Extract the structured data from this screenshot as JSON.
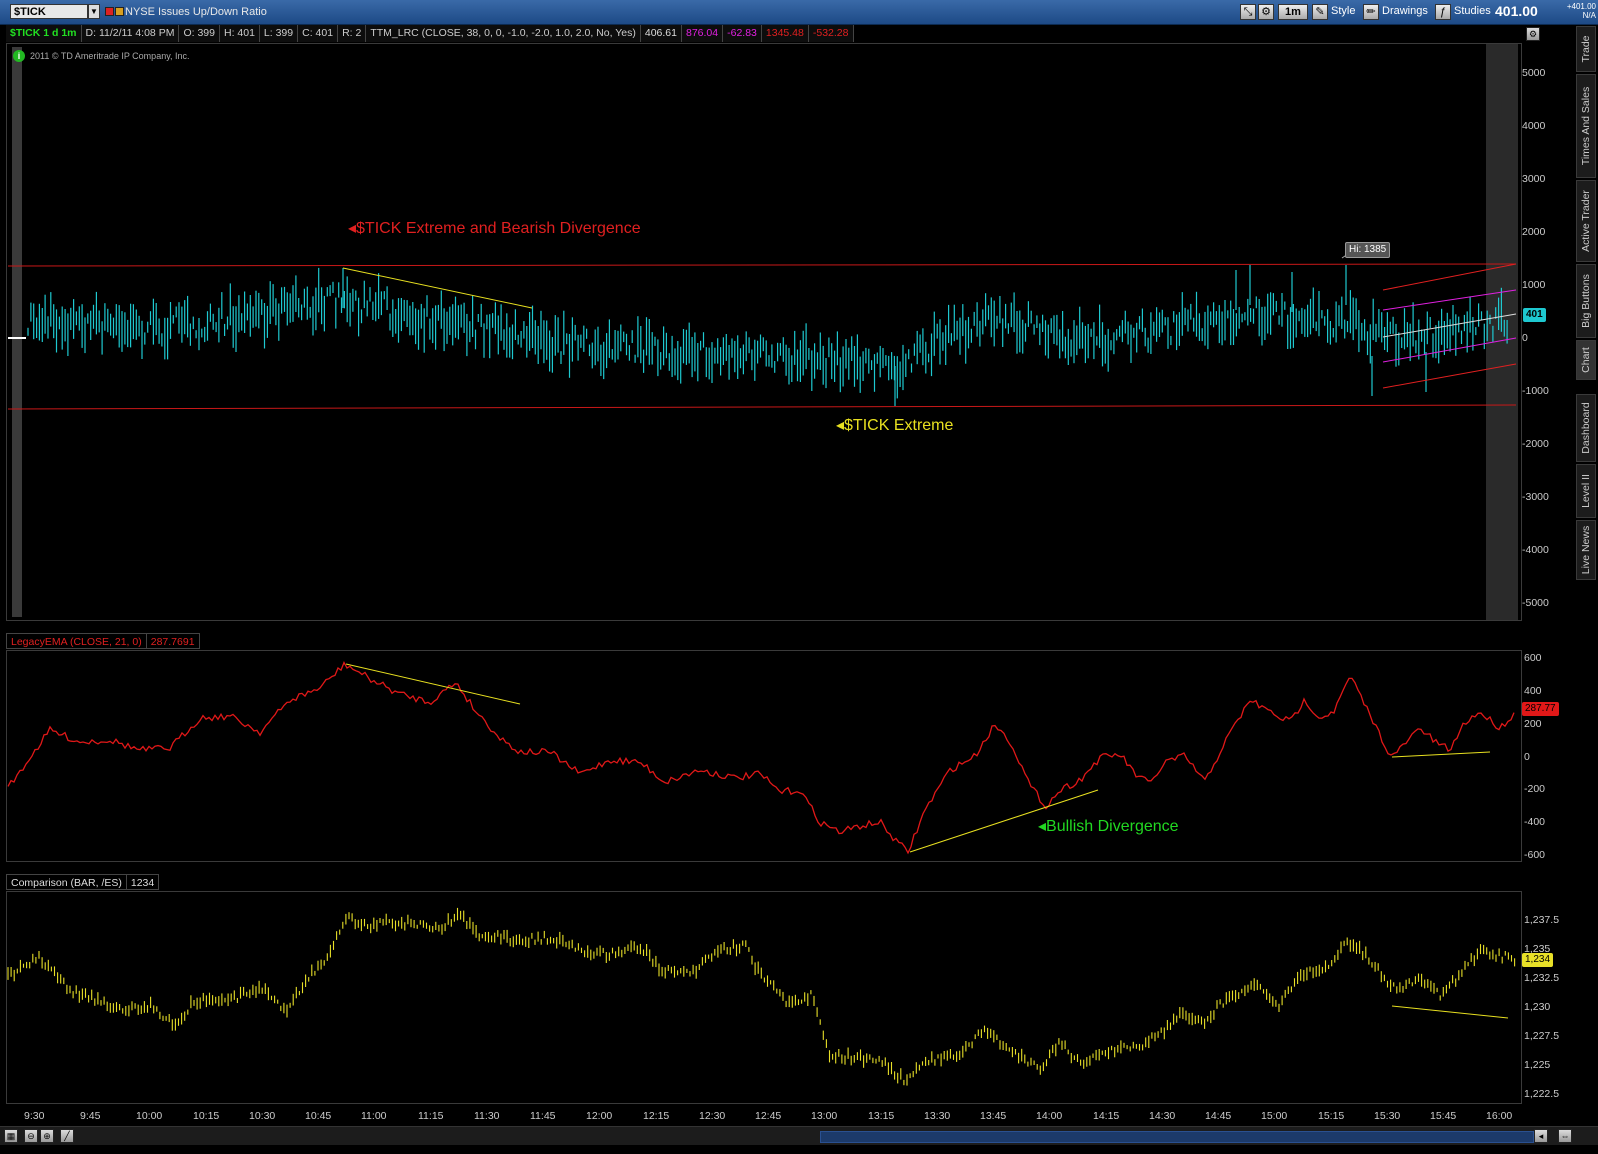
{
  "titlebar": {
    "symbol": "$TICK",
    "description": "NYSE Issues Up/Down Ratio",
    "timeframe_btn": "1m",
    "style_label": "Style",
    "drawings_label": "Drawings",
    "studies_label": "Studies",
    "last_price": "401.00",
    "net_change": "+401.00",
    "net_pct": "N/A"
  },
  "header": {
    "chart_label": "$TICK 1 d 1m",
    "date": "D: 11/2/11 4:08 PM",
    "open": "O: 399",
    "high": "H: 401",
    "low": "L: 399",
    "close": "C: 401",
    "r": "R: 2",
    "study": "TTM_LRC (CLOSE, 38, 0, 0, -1.0, -2.0, 1.0, 2.0, No, Yes)",
    "v1": "406.61",
    "v2": "876.04",
    "v3": "-62.83",
    "v4": "1345.48",
    "v5": "-532.28",
    "copyright": "2011 © TD Ameritrade IP Company, Inc."
  },
  "colors": {
    "tick": "#1ec8d0",
    "ema": "#e01818",
    "es": "#e8e028",
    "extreme": "#c81818",
    "trend": "#e8e020",
    "bull": "#22d822",
    "lrc_outer": "#e02020",
    "lrc_inner": "#e020e0"
  },
  "tick_panel": {
    "y_labels": [
      "5000",
      "4000",
      "3000",
      "2000",
      "1000",
      "0",
      "-1000",
      "-2000",
      "-3000",
      "-4000",
      "-5000"
    ],
    "hi_tag": "Hi: 1385",
    "price_tag": "401",
    "ann_bear": "$TICK Extreme and Bearish Divergence",
    "ann_extreme": "$TICK Extreme"
  },
  "ema_panel": {
    "title": "LegacyEMA (CLOSE, 21, 0)",
    "value": "287.7691",
    "y_labels": [
      "600",
      "400",
      "200",
      "0",
      "-200",
      "-400",
      "-600"
    ],
    "price_tag": "287.77",
    "ann_bull": "Bullish Divergence"
  },
  "cmp_panel": {
    "title": "Comparison (BAR, /ES)",
    "value": "1234",
    "y_labels": [
      "1,237.5",
      "1,235",
      "1,232.5",
      "1,230",
      "1,227.5",
      "1,225",
      "1,222.5"
    ],
    "price_tag": "1,234"
  },
  "time_labels": [
    "9:30",
    "9:45",
    "10:00",
    "10:15",
    "10:30",
    "10:45",
    "11:00",
    "11:15",
    "11:30",
    "11:45",
    "12:00",
    "12:15",
    "12:30",
    "12:45",
    "13:00",
    "13:15",
    "13:30",
    "13:45",
    "14:00",
    "14:15",
    "14:30",
    "14:45",
    "15:00",
    "15:15",
    "15:30",
    "15:45",
    "16:00"
  ],
  "side_tabs": [
    "Trade",
    "Times And Sales",
    "Active Trader",
    "Big Buttons",
    "Chart",
    "Dashboard",
    "Level II",
    "Live News"
  ]
}
